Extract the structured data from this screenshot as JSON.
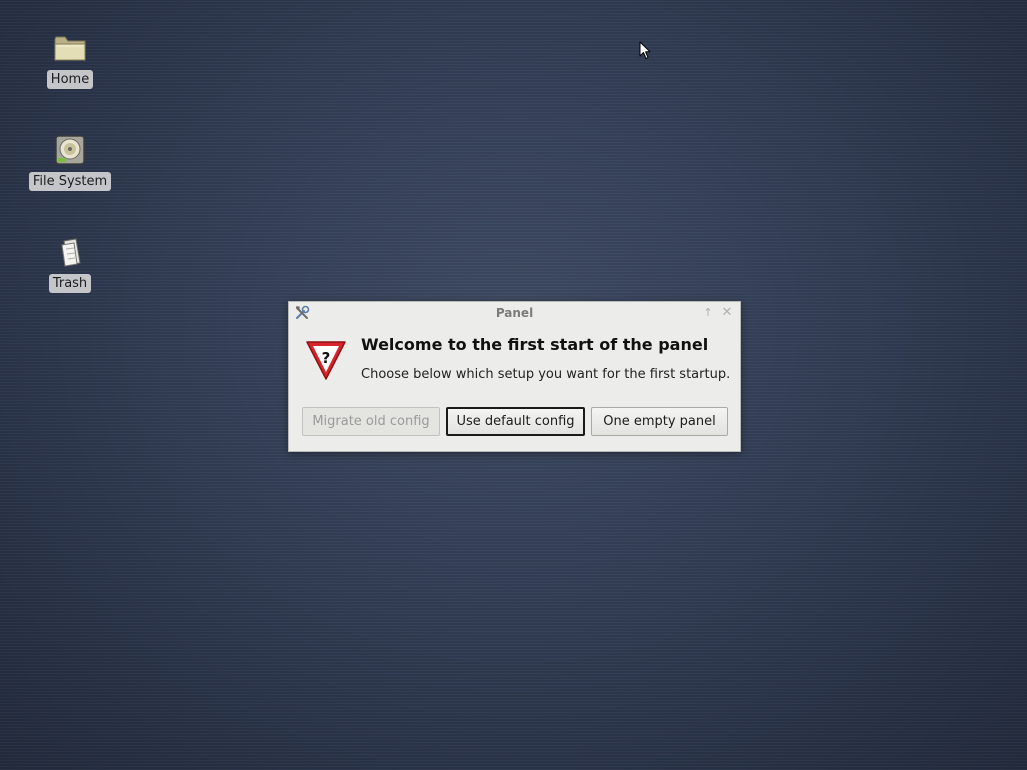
{
  "desktop": {
    "background_color": "#36425a",
    "icons": [
      {
        "label": "Home",
        "icon": "folder-icon"
      },
      {
        "label": "File System",
        "icon": "hard-drive-icon"
      },
      {
        "label": "Trash",
        "icon": "trash-icon"
      }
    ]
  },
  "dialog": {
    "title": "Panel",
    "app_icon": "settings-tools-icon",
    "title_buttons": {
      "maximize": "↑",
      "close": "✕"
    },
    "warning_icon": "question-warning-icon",
    "heading": "Welcome to the first start of the panel",
    "body": "Choose below which setup you want for the first startup.",
    "buttons": {
      "migrate": {
        "label": "Migrate old config",
        "enabled": false
      },
      "default": {
        "label": "Use default config",
        "enabled": true,
        "focused": true
      },
      "empty": {
        "label": "One empty panel",
        "enabled": true
      }
    },
    "accent_colors": {
      "warning_red": "#d7252a",
      "dialog_bg": "#ececea"
    }
  }
}
